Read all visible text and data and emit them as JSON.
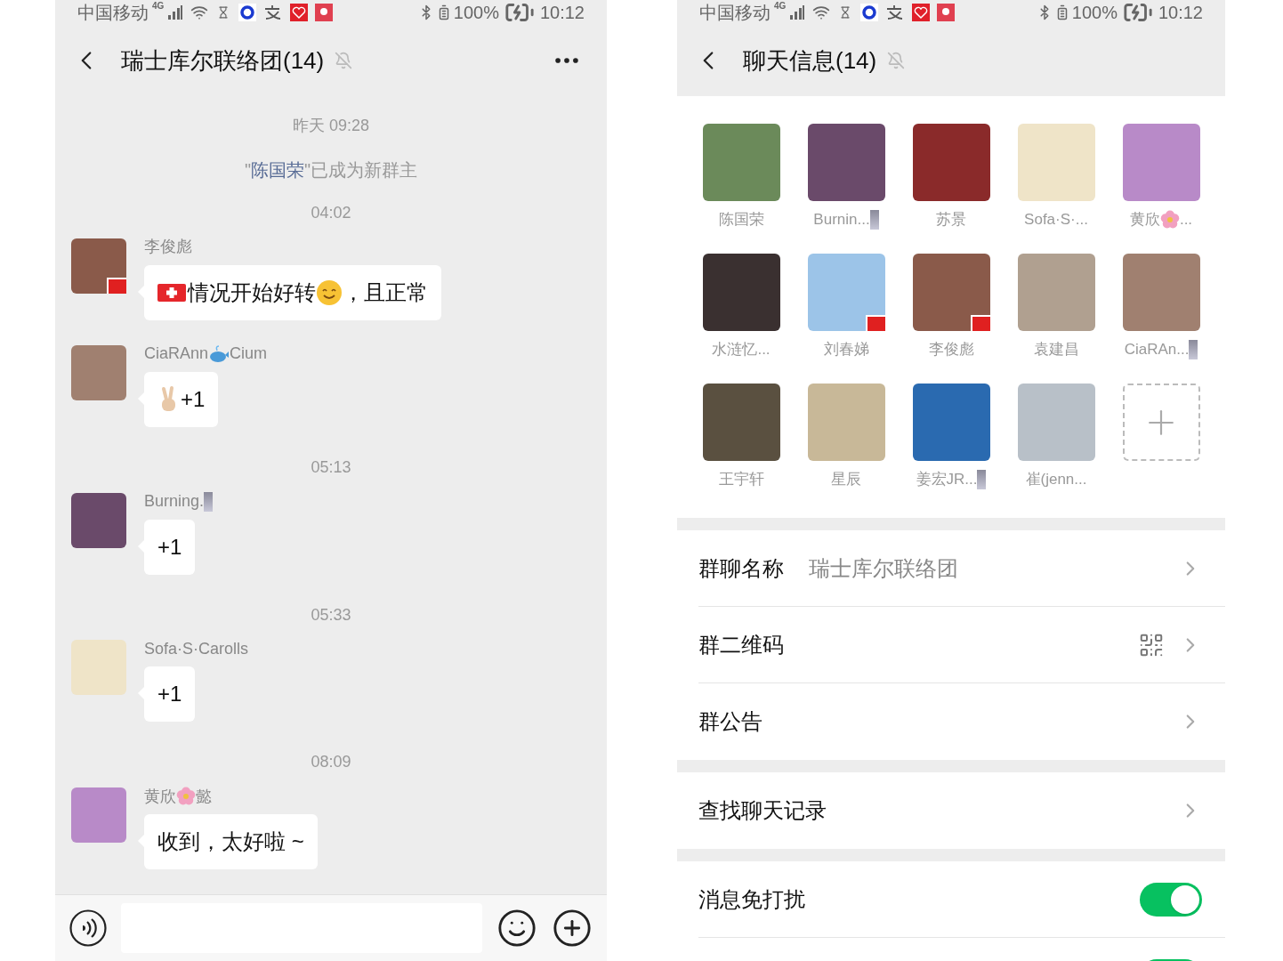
{
  "chat_screen": {
    "status_bar": {
      "carrier": "中国移动",
      "network": "4G",
      "battery": "100%",
      "time": "10:12"
    },
    "header": {
      "title": "瑞士库尔联络团(14)",
      "muted": true
    },
    "items": [
      {
        "kind": "time",
        "text": "昨天 09:28"
      },
      {
        "kind": "system",
        "parts": [
          {
            "kind": "text",
            "text": "\""
          },
          {
            "kind": "link",
            "text": "陈国荣"
          },
          {
            "kind": "text",
            "text": "\"已成为新群主"
          }
        ]
      },
      {
        "kind": "time",
        "text": "04:02"
      },
      {
        "kind": "message",
        "flag_badge": true,
        "sender": [
          {
            "kind": "text",
            "text": "李俊彪"
          }
        ],
        "content": [
          {
            "kind": "swiss-flag"
          },
          {
            "kind": "text",
            "text": "情况开始好转"
          },
          {
            "kind": "smile"
          },
          {
            "kind": "text",
            "text": "，且正常"
          }
        ]
      },
      {
        "kind": "message",
        "flag_badge": false,
        "sender": [
          {
            "kind": "text",
            "text": "CiaRAnn"
          },
          {
            "kind": "whale"
          },
          {
            "kind": "text",
            "text": " Cium"
          }
        ],
        "content": [
          {
            "kind": "peace-hand"
          },
          {
            "kind": "text",
            "text": " +1"
          }
        ]
      },
      {
        "kind": "time",
        "text": "05:13"
      },
      {
        "kind": "message",
        "flag_badge": false,
        "sender": [
          {
            "kind": "text",
            "text": "Burning."
          },
          {
            "kind": "pixel-image"
          }
        ],
        "content": [
          {
            "kind": "text",
            "text": "+1"
          }
        ]
      },
      {
        "kind": "time",
        "text": "05:33"
      },
      {
        "kind": "message",
        "flag_badge": false,
        "sender": [
          {
            "kind": "text",
            "text": "Sofa·S·Carolls"
          }
        ],
        "content": [
          {
            "kind": "text",
            "text": "+1"
          }
        ]
      },
      {
        "kind": "time",
        "text": "08:09"
      },
      {
        "kind": "message",
        "flag_badge": false,
        "sender": [
          {
            "kind": "text",
            "text": "黄欣"
          },
          {
            "kind": "flower"
          },
          {
            "kind": "text",
            "text": "懿"
          }
        ],
        "content": [
          {
            "kind": "text",
            "text": "收到，太好啦 ~"
          }
        ]
      }
    ]
  },
  "info_screen": {
    "status_bar": {
      "carrier": "中国移动",
      "network": "4G",
      "battery": "100%",
      "time": "10:12"
    },
    "header": {
      "title": "聊天信息(14)",
      "muted": true
    },
    "members": [
      {
        "flag_badge": false,
        "name": [
          {
            "kind": "text",
            "text": "陈国荣"
          }
        ]
      },
      {
        "flag_badge": false,
        "name": [
          {
            "kind": "text",
            "text": "Burnin..."
          },
          {
            "kind": "pixel-image"
          }
        ]
      },
      {
        "flag_badge": false,
        "name": [
          {
            "kind": "text",
            "text": "苏景"
          }
        ]
      },
      {
        "flag_badge": false,
        "name": [
          {
            "kind": "text",
            "text": "Sofa·S·..."
          }
        ]
      },
      {
        "flag_badge": false,
        "name": [
          {
            "kind": "text",
            "text": "黄欣"
          },
          {
            "kind": "flower"
          },
          {
            "kind": "text",
            "text": "..."
          }
        ]
      },
      {
        "flag_badge": false,
        "name": [
          {
            "kind": "text",
            "text": "水涟忆..."
          }
        ]
      },
      {
        "flag_badge": true,
        "name": [
          {
            "kind": "text",
            "text": "刘春娣"
          }
        ]
      },
      {
        "flag_badge": true,
        "name": [
          {
            "kind": "text",
            "text": "李俊彪"
          }
        ]
      },
      {
        "flag_badge": false,
        "name": [
          {
            "kind": "text",
            "text": "袁建昌"
          }
        ]
      },
      {
        "flag_badge": false,
        "name": [
          {
            "kind": "text",
            "text": "CiaRAn..."
          },
          {
            "kind": "pixel-image"
          }
        ]
      },
      {
        "flag_badge": false,
        "name": [
          {
            "kind": "text",
            "text": "王宇轩"
          }
        ]
      },
      {
        "flag_badge": false,
        "name": [
          {
            "kind": "text",
            "text": "星辰"
          }
        ]
      },
      {
        "flag_badge": false,
        "name": [
          {
            "kind": "text",
            "text": "姜宏JR..."
          },
          {
            "kind": "pixel-image"
          }
        ]
      },
      {
        "flag_badge": false,
        "name": [
          {
            "kind": "text",
            "text": "崔(jenn..."
          }
        ]
      }
    ],
    "settings_groups": [
      [
        {
          "kind": "value",
          "label": "群聊名称",
          "value": "瑞士库尔联络团"
        },
        {
          "kind": "qr",
          "label": "群二维码"
        },
        {
          "kind": "plain",
          "label": "群公告"
        }
      ],
      [
        {
          "kind": "plain",
          "label": "查找聊天记录"
        }
      ],
      [
        {
          "kind": "toggle",
          "label": "消息免打扰",
          "on": true
        },
        {
          "kind": "toggle",
          "on": true
        }
      ]
    ]
  }
}
